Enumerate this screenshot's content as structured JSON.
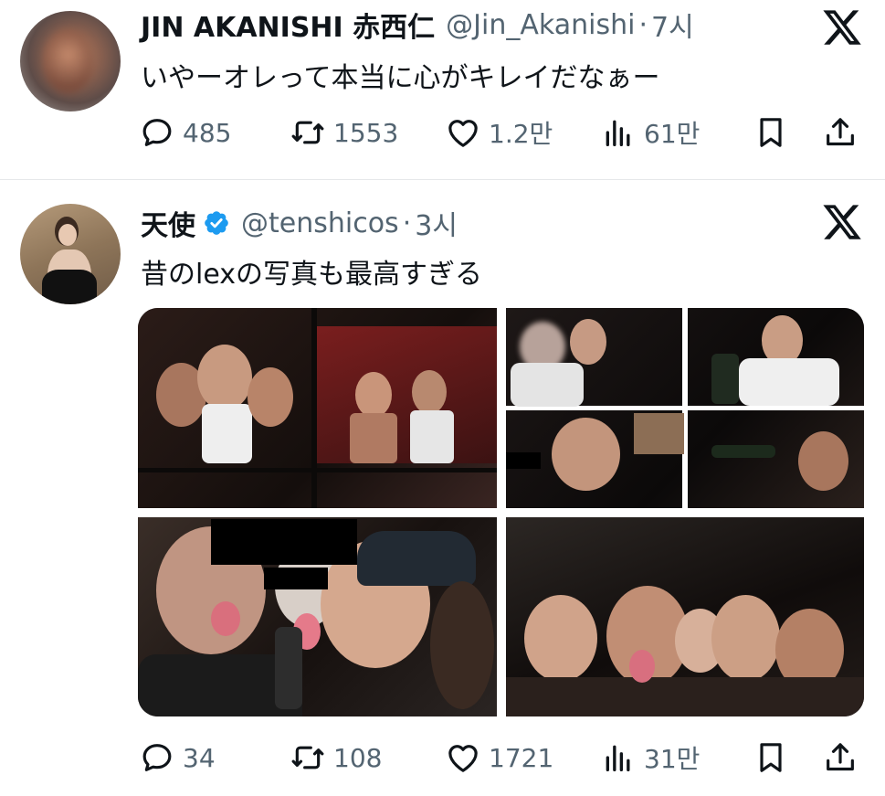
{
  "tweets": [
    {
      "name": "JIN AKANISHI 赤西仁",
      "handle": "@Jin_Akanishi",
      "separator": "·",
      "time": "7시",
      "text": "いやーオレって本当に心がキレイだなぁー",
      "verified": false,
      "stats": {
        "replies": "485",
        "retweets": "1553",
        "likes": "1.2만",
        "views": "61만"
      }
    },
    {
      "name": "天使",
      "handle": "@tenshicos",
      "separator": "·",
      "time": "3시",
      "text": "昔のlexの写真も最高すぎる",
      "verified": true,
      "stats": {
        "replies": "34",
        "retweets": "108",
        "likes": "1721",
        "views": "31만"
      }
    }
  ],
  "icons": {
    "brand": "x-logo-icon",
    "reply": "reply-icon",
    "retweet": "retweet-icon",
    "like": "heart-icon",
    "views": "views-icon",
    "bookmark": "bookmark-icon",
    "share": "share-icon",
    "verified": "verified-badge-icon"
  },
  "colors": {
    "text": "#0f1419",
    "secondary": "#536471",
    "verified": "#1d9bf0",
    "divider": "#e6e8ea"
  }
}
